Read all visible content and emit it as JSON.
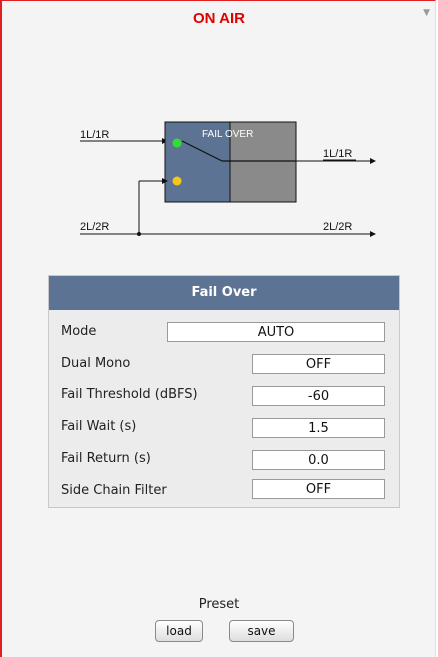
{
  "header": {
    "title": "ON AIR"
  },
  "diagram": {
    "input1": "1L/1R",
    "input2": "2L/2R",
    "output1": "1L/1R",
    "output2": "2L/2R",
    "block_label": "FAIL OVER",
    "colors": {
      "primary_dot": "#33dd33",
      "secondary_dot": "#f5c518",
      "block_left": "#5d7394",
      "block_right": "#8a8a8a"
    }
  },
  "panel": {
    "title": "Fail Over",
    "rows": [
      {
        "label": "Mode",
        "value": "AUTO"
      },
      {
        "label": "Dual Mono",
        "value": "OFF"
      },
      {
        "label": "Fail Threshold (dBFS)",
        "value": "-60"
      },
      {
        "label": "Fail Wait (s)",
        "value": "1.5"
      },
      {
        "label": "Fail Return (s)",
        "value": "0.0"
      },
      {
        "label": "Side Chain Filter",
        "value": "OFF"
      }
    ]
  },
  "preset": {
    "label": "Preset",
    "load_label": "load",
    "save_label": "save"
  }
}
